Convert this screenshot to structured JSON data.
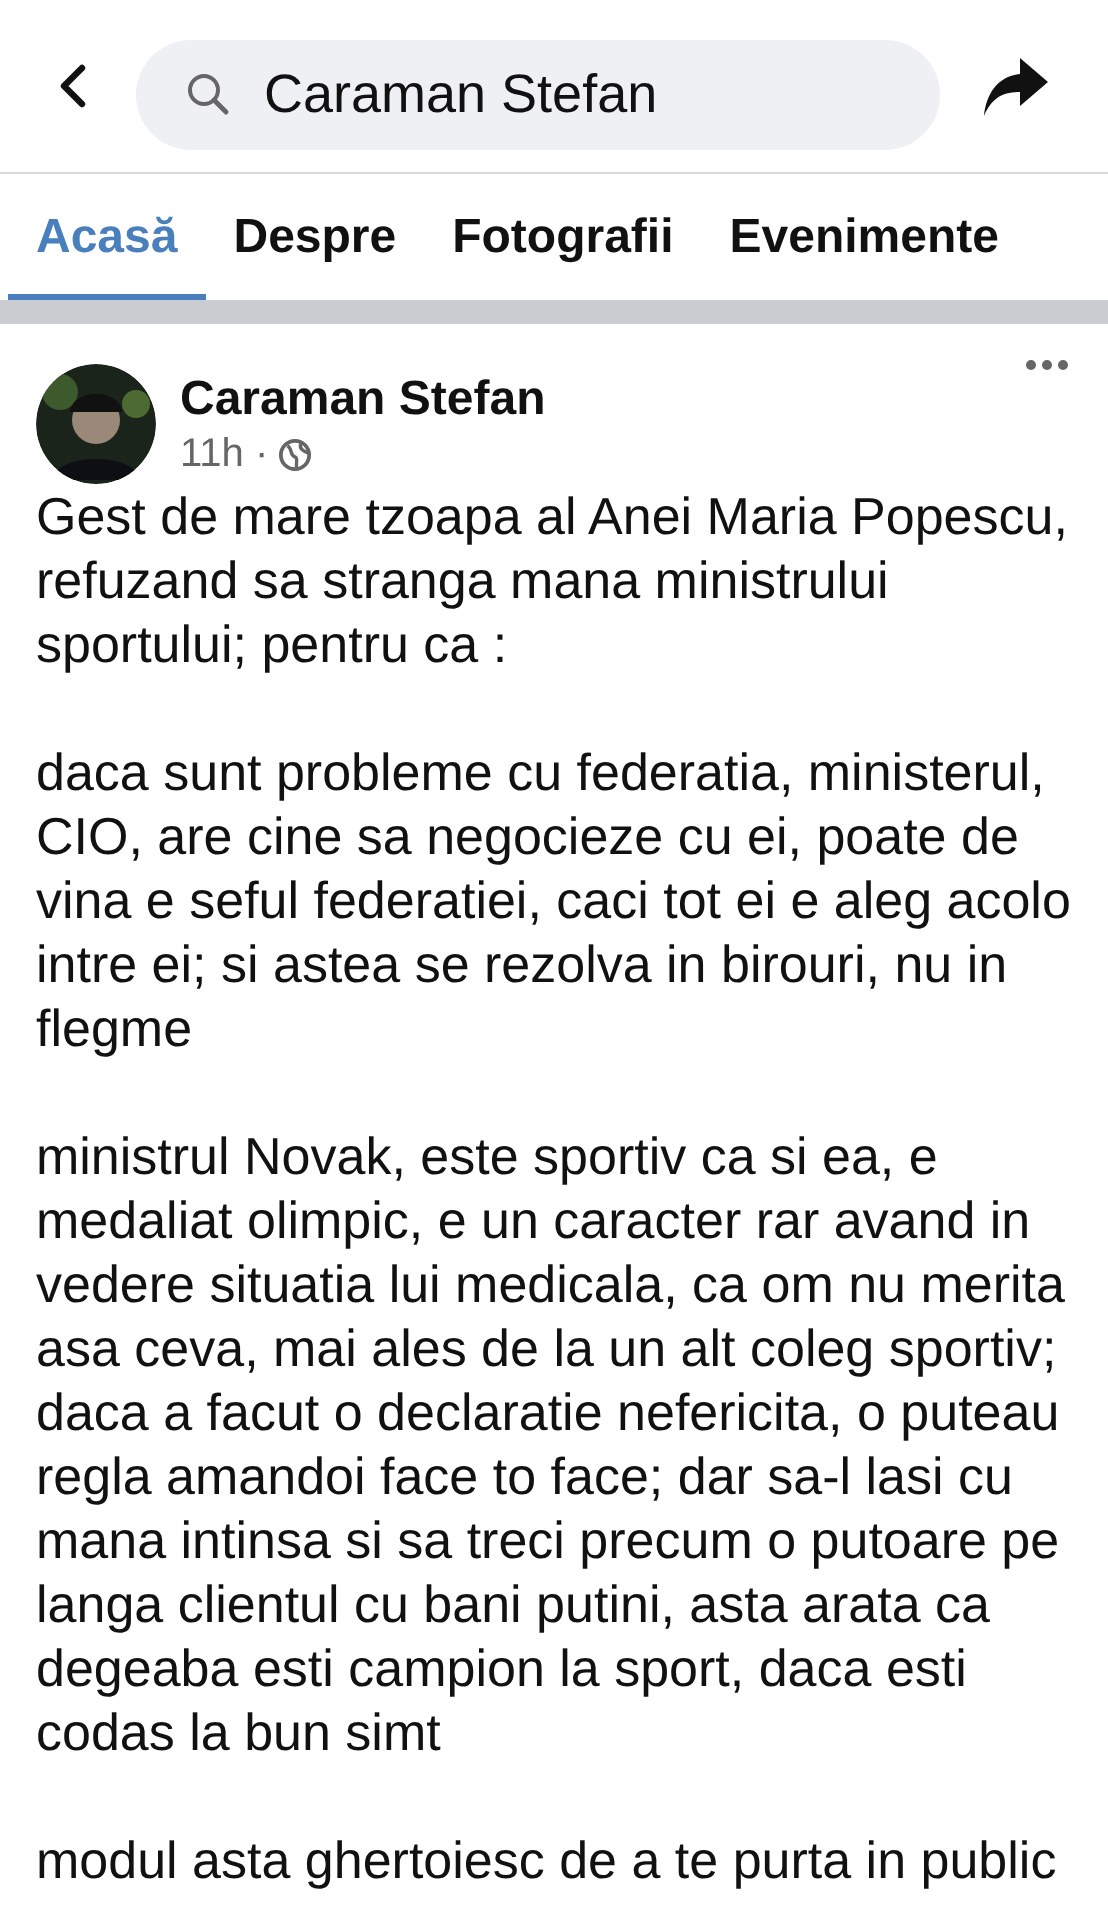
{
  "search": {
    "value": "Caraman Stefan"
  },
  "tabs": [
    {
      "label": "Acasă",
      "selected": true
    },
    {
      "label": "Despre",
      "selected": false
    },
    {
      "label": "Fotografii",
      "selected": false
    },
    {
      "label": "Evenimente",
      "selected": false
    }
  ],
  "post": {
    "author": "Caraman Stefan",
    "time": "11h ·",
    "paragraphs": [
      [
        "Gest de mare tzoapa al Anei Maria Popescu,",
        "refuzand sa stranga mana ministrului",
        "sportului; pentru ca :"
      ],
      [
        "daca sunt probleme cu federatia, ministerul,",
        "CIO, are cine sa negocieze cu ei, poate de",
        "vina e seful federatiei, caci tot ei e aleg acolo",
        "intre ei; si astea se rezolva in birouri, nu in",
        "flegme"
      ],
      [
        "ministrul Novak, este sportiv ca si ea, e",
        "medaliat olimpic, e un caracter rar avand in",
        "vedere situatia lui medicala, ca om nu merita",
        "asa ceva, mai ales de la un alt coleg sportiv;",
        "daca a facut o declaratie nefericita, o puteau",
        "regla amandoi face to face; dar sa-l lasi cu",
        "mana intinsa si sa treci precum o putoare pe",
        "langa clientul cu bani putini, asta arata ca",
        "degeaba esti campion la sport, daca esti",
        "codas la bun simt"
      ],
      [
        "modul asta ghertoiesc de a te purta in public"
      ]
    ]
  }
}
